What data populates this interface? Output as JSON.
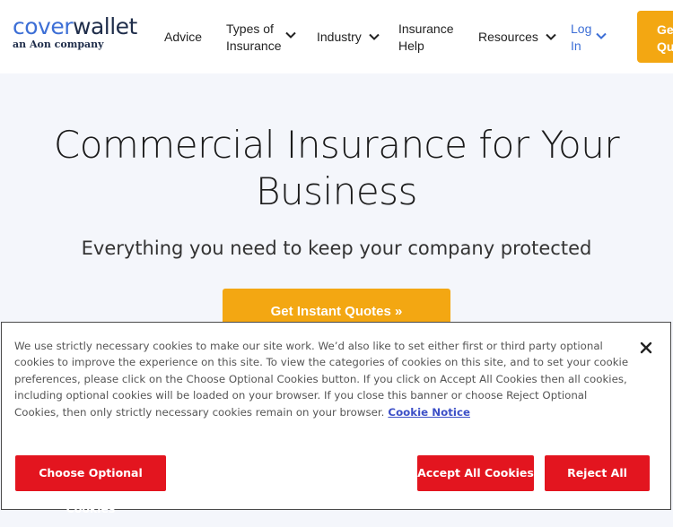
{
  "header": {
    "logo": {
      "cover": "cover",
      "wallet": "wallet",
      "sub": "an Aon company"
    },
    "nav": {
      "advice": "Advice",
      "types_line1": "Types of",
      "types_line2": "Insurance",
      "industry": "Industry",
      "help_line1": "Insurance",
      "help_line2": "Help",
      "resources": "Resources",
      "login_line1": "Log",
      "login_line2": "In"
    },
    "cta_line1": "Get",
    "cta_line2": "Quo"
  },
  "hero": {
    "title_line1": "Commercial Insurance for Your",
    "title_line2": "Business",
    "subtitle": "Everything you need to keep your company protected",
    "cta": "Get Instant Quotes »"
  },
  "cookie_banner": {
    "text": "We use strictly necessary cookies to make our site work. We’d also like to set either first or third party optional cookies to improve the experience on this site. To view the categories of cookies on this site, and to set your cookie preferences, please click on the Choose Optional Cookies button. If you click on Accept All Cookies then all cookies, including optional cookies will be loaded on your browser. If you close this banner or choose Reject Optional Cookies, then only strictly necessary cookies remain on your browser.",
    "link": "Cookie Notice",
    "choose_btn": "Choose Optional Cookies",
    "accept_btn": "Accept All Cookies",
    "reject_btn": "Reject All"
  },
  "colors": {
    "brand_blue": "#3d6fd6",
    "brand_navy": "#1f2d4a",
    "accent_orange": "#f3a712",
    "cookie_red": "#e3151f",
    "link_blue": "#3c4fc7"
  },
  "icons": [
    "chevron-down-icon",
    "close-icon"
  ]
}
